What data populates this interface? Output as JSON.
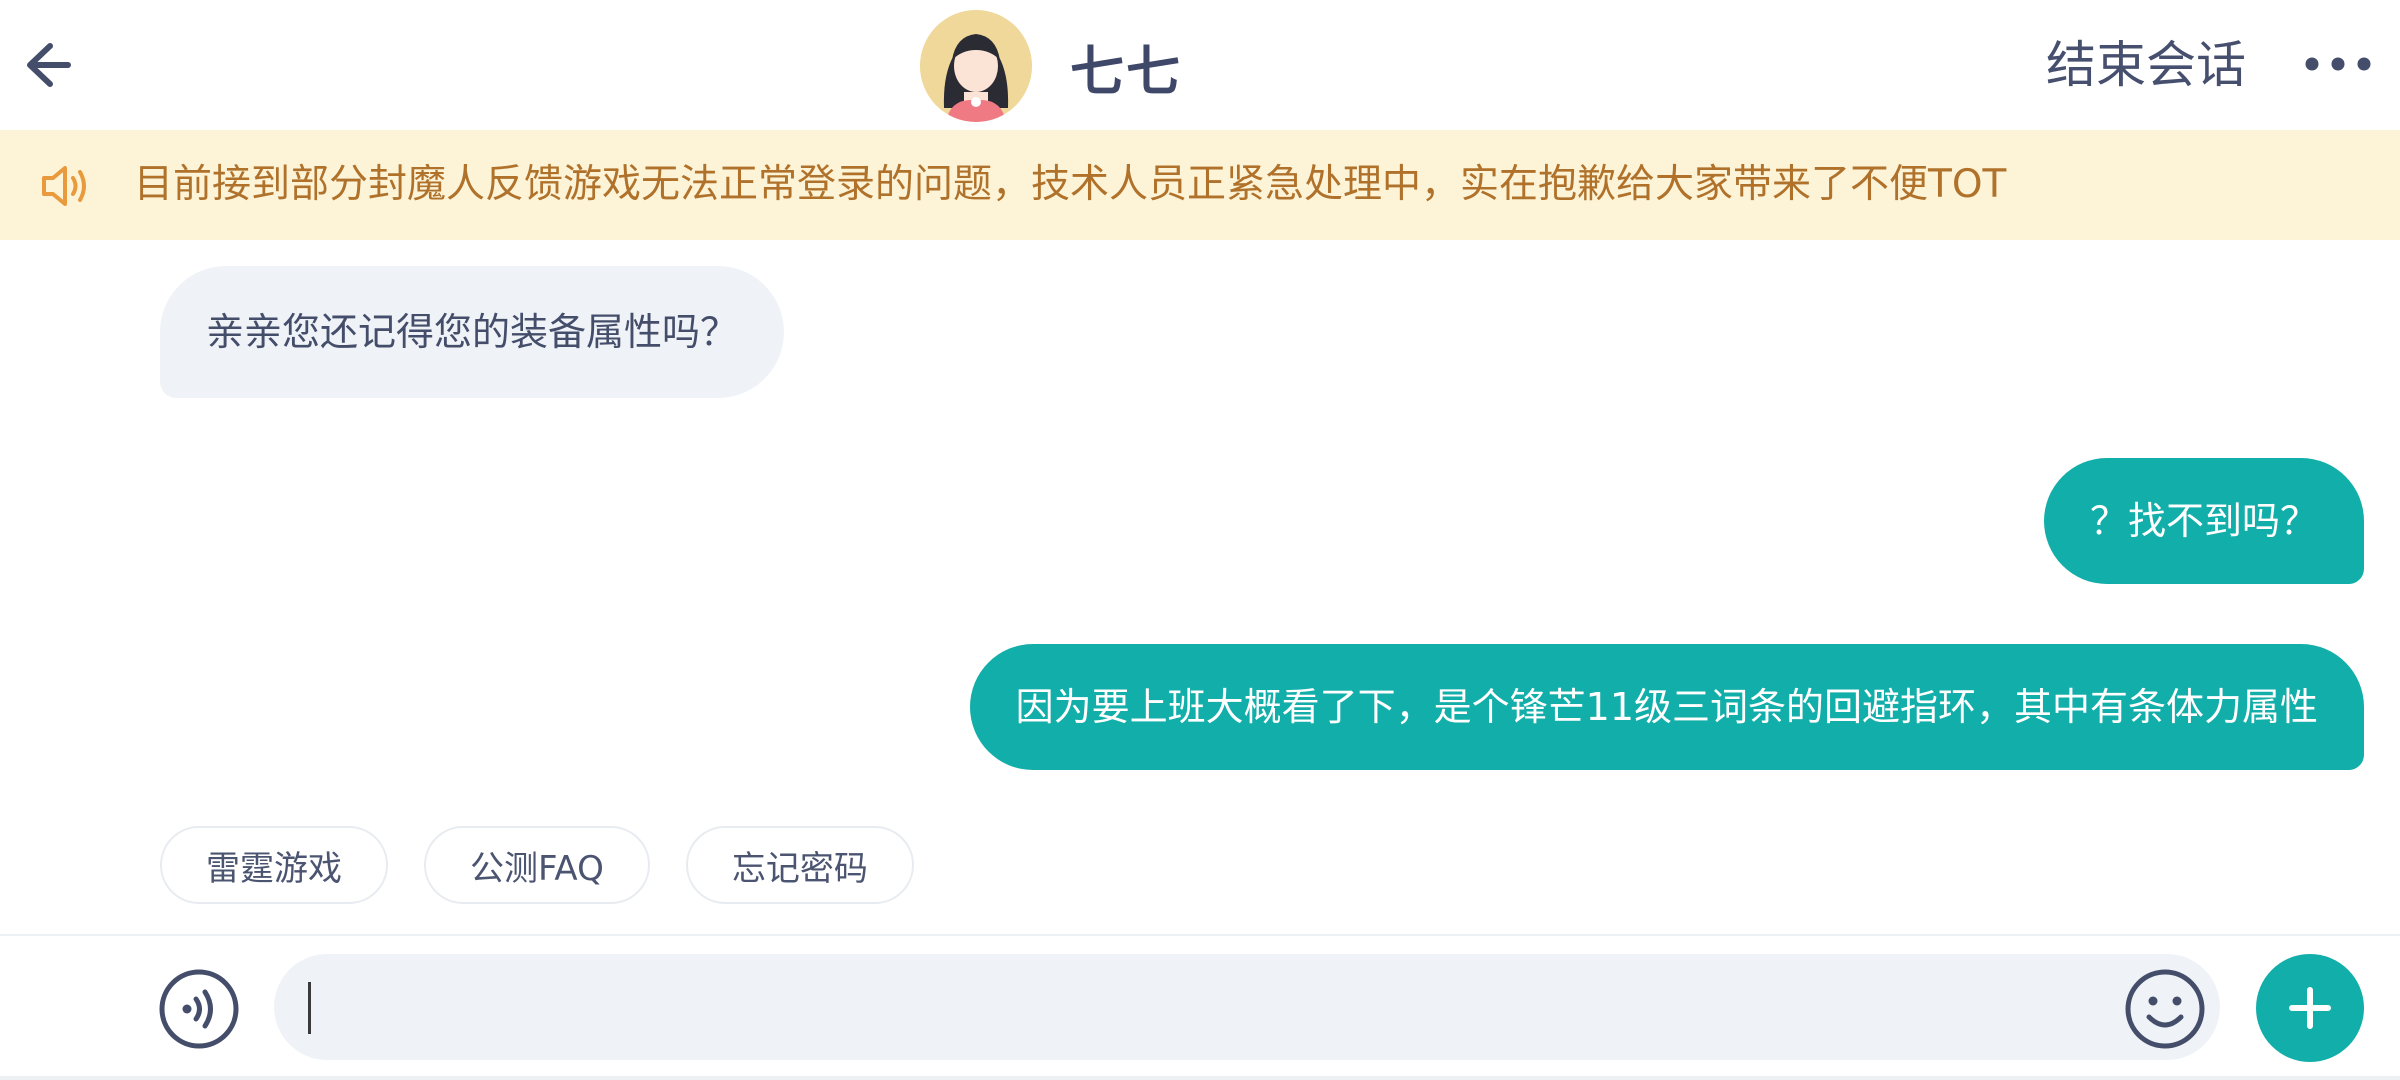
{
  "header": {
    "title": "七七",
    "end_session_label": "结束会话"
  },
  "notice": {
    "text": "目前接到部分封魔人反馈游戏无法正常登录的问题，技术人员正紧急处理中，实在抱歉给大家带来了不便TOT"
  },
  "messages": [
    {
      "side": "agent",
      "text": "亲亲您还记得您的装备属性吗？"
    },
    {
      "side": "user",
      "text": "？找不到吗？"
    },
    {
      "side": "user",
      "text": "因为要上班大概看了下，是个锋芒11级三词条的回避指环，其中有条体力属性"
    }
  ],
  "quick_replies": [
    "雷霆游戏",
    "公测FAQ",
    "忘记密码"
  ],
  "input": {
    "value": "",
    "placeholder": ""
  },
  "colors": {
    "accent": "#12aea9",
    "notice_bg": "#fdf4d8",
    "notice_text": "#b0722b"
  },
  "icons": [
    "back-arrow-icon",
    "more-icon",
    "speaker-icon",
    "voice-icon",
    "emoji-icon",
    "plus-icon"
  ]
}
